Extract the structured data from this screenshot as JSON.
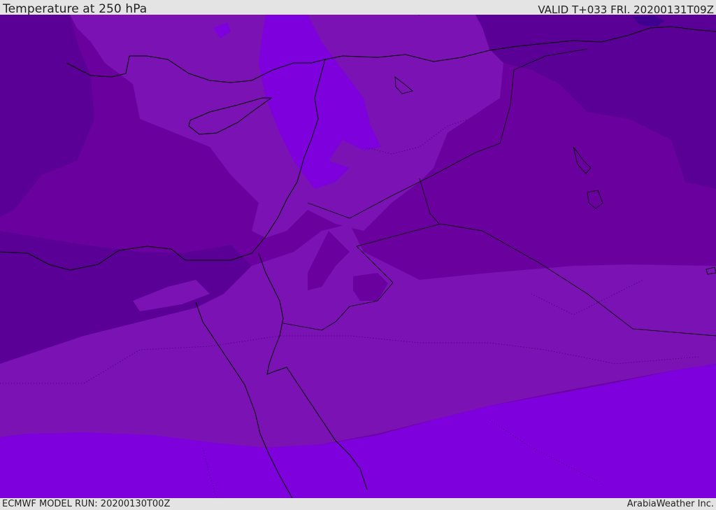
{
  "header": {
    "title": "Temperature at 250 hPa",
    "valid": "VALID T+033 FRI. 20200131T09Z"
  },
  "footer": {
    "model_run": "ECMWF MODEL RUN: 20200130T00Z",
    "credit": "ArabiaWeather Inc."
  },
  "colors": {
    "band_darkest": "#3f0090",
    "band_dark": "#5a0096",
    "band_mid": "#6a009e",
    "band_light": "#7a12b4",
    "band_lightest": "#7e00dc",
    "coast_line": "#000000"
  }
}
